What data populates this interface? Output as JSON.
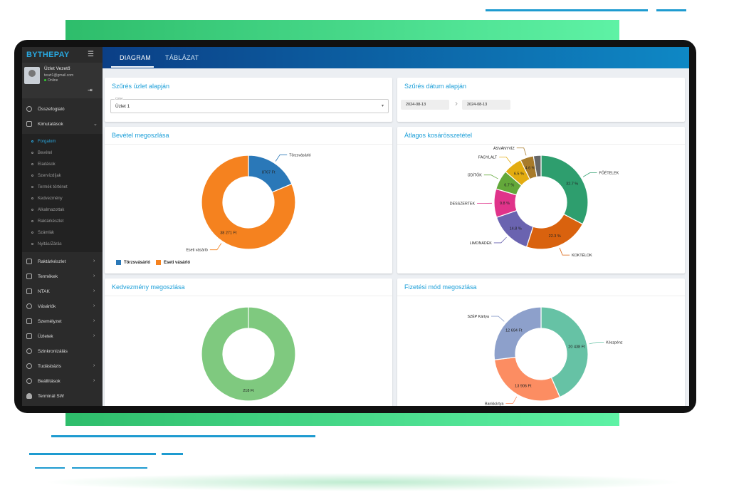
{
  "app": {
    "brand": "BYTHEPAY"
  },
  "user": {
    "name": "Üzlet Vezető",
    "email": "teszt1@gmail.com",
    "status": "Online"
  },
  "sidebar": {
    "items": [
      {
        "label": "Összefoglaló",
        "icon": "dashboard-icon"
      },
      {
        "label": "Kimutatások",
        "icon": "chart-icon"
      },
      {
        "label": "Raktárkészlet",
        "icon": "grid-icon"
      },
      {
        "label": "Termékek",
        "icon": "box-icon"
      },
      {
        "label": "NTAK",
        "icon": "id-card-icon"
      },
      {
        "label": "Vásárlók",
        "icon": "person-icon"
      },
      {
        "label": "Személyzet",
        "icon": "briefcase-icon"
      },
      {
        "label": "Üzletek",
        "icon": "store-icon"
      },
      {
        "label": "Szinkronizálás",
        "icon": "sync-icon"
      },
      {
        "label": "Tudásbázis",
        "icon": "help-icon"
      },
      {
        "label": "Beállítások",
        "icon": "settings-icon"
      },
      {
        "label": "Terminál SW",
        "icon": "android-icon"
      }
    ],
    "subitems": [
      "Forgalom",
      "Bevétel",
      "Eladások",
      "Szervízdíjak",
      "Termék történet",
      "Kedvezmény",
      "Alkalmazottak",
      "Raktárkészlet",
      "Számlák",
      "Nyitás/Zárás"
    ]
  },
  "tabs": {
    "diagram": "DIAGRAM",
    "table": "TÁBLÁZAT"
  },
  "filters": {
    "store_title": "Szűrés üzlet alapján",
    "store_label": "Üzlet",
    "store_value": "Üzlet 1",
    "date_title": "Szűrés dátum alapján",
    "date_from": "2024-08-13",
    "date_to": "2024-08-13"
  },
  "cards": {
    "revenue_title": "Bevétel megoszlása",
    "basket_title": "Átlagos kosárösszetétel",
    "discount_title": "Kedvezmény megoszlása",
    "payment_title": "Fizetési mód megoszlása"
  },
  "colors": {
    "accent": "#1a9ed8",
    "sidebar": "#2b2b2b",
    "header_from": "#0b3f86",
    "header_to": "#0e88c5"
  },
  "chart_data": [
    {
      "type": "pie",
      "title": "Bevétel megoszlása",
      "categories": [
        "Törzsvásárló",
        "Eseti vásárló"
      ],
      "values": [
        8767,
        38271
      ],
      "labels": [
        "8767 Ft",
        "38 271 Ft"
      ],
      "colors": [
        "#2a78b8",
        "#f5821f"
      ],
      "legend": "bottom-left"
    },
    {
      "type": "pie",
      "title": "Átlagos kosárösszetétel",
      "categories": [
        "FŐÉTELEK",
        "KOKTÉLOK",
        "LIMONÁDÉK",
        "DESSZERTEK",
        "ÜDÍTŐK",
        "FAGYLALT",
        "ÁSVÁNYVÍZ",
        ""
      ],
      "values": [
        32.7,
        22.3,
        14.8,
        9.8,
        6.7,
        6.5,
        4.6,
        2.6
      ],
      "labels": [
        "32.7 %",
        "22.3 %",
        "14.8 %",
        "9.8 %",
        "6.7 %",
        "6.5 %",
        "4.6 %",
        ""
      ],
      "colors": [
        "#2e9e6e",
        "#d9620e",
        "#6a63b0",
        "#e0338a",
        "#63a83a",
        "#e3ac10",
        "#a87b2a",
        "#666666"
      ]
    },
    {
      "type": "pie",
      "title": "Kedvezmény megoszlása",
      "categories": [
        ""
      ],
      "values": [
        218
      ],
      "labels": [
        "218 Ft"
      ],
      "colors": [
        "#7fc97f"
      ]
    },
    {
      "type": "pie",
      "title": "Fizetési mód megoszlása",
      "categories": [
        "Készpénz",
        "Bankkártya",
        "SZÉP Kártya"
      ],
      "values": [
        20438,
        13906,
        12694
      ],
      "labels": [
        "20 438 Ft",
        "13 906 Ft",
        "12 694 Ft"
      ],
      "colors": [
        "#66c2a5",
        "#fc8d62",
        "#8da0cb"
      ]
    }
  ]
}
